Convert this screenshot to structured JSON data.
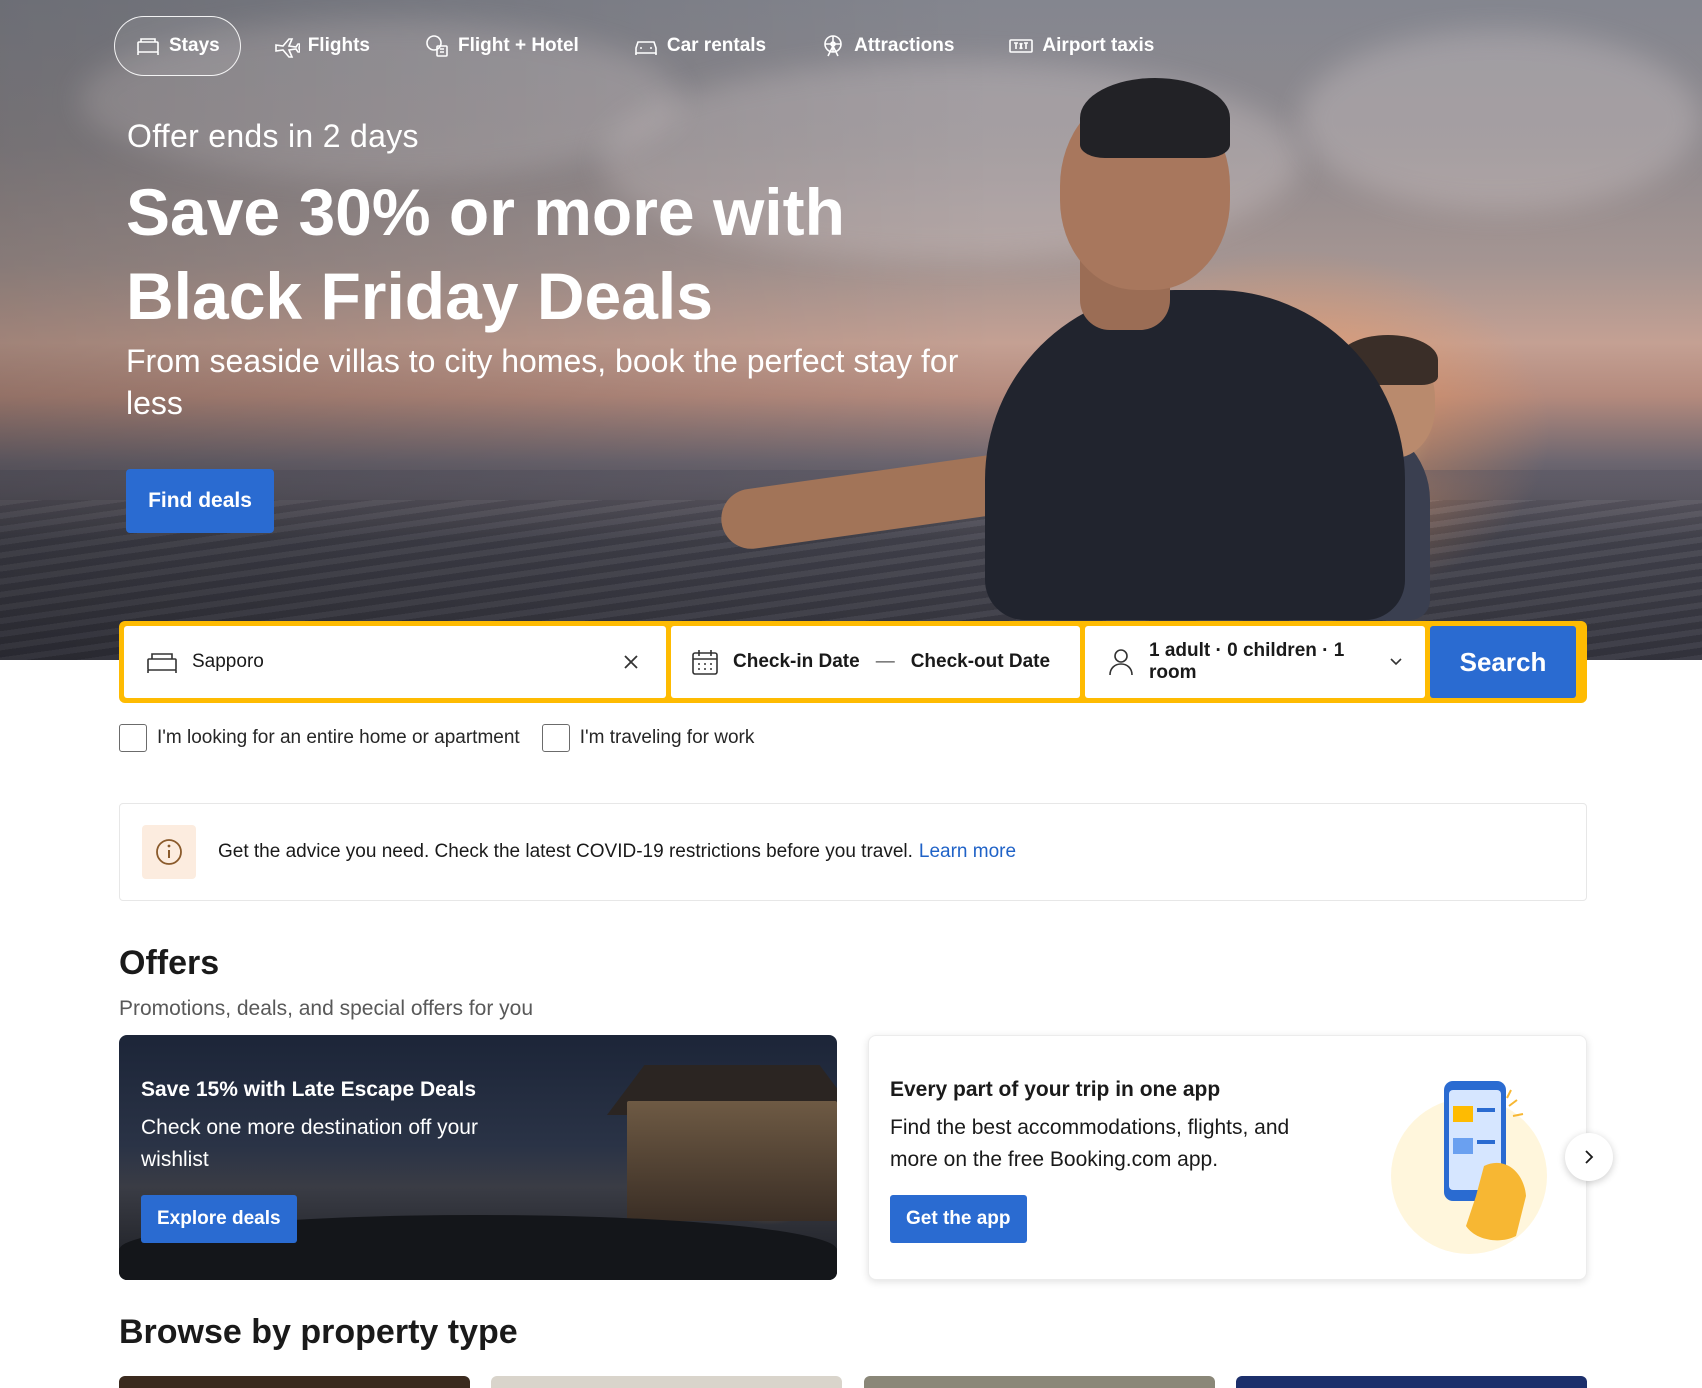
{
  "nav": {
    "items": [
      {
        "label": "Stays",
        "icon": "bed-icon",
        "active": true
      },
      {
        "label": "Flights",
        "icon": "plane-icon",
        "active": false
      },
      {
        "label": "Flight + Hotel",
        "icon": "flight-hotel-icon",
        "active": false
      },
      {
        "label": "Car rentals",
        "icon": "car-icon",
        "active": false
      },
      {
        "label": "Attractions",
        "icon": "ferris-wheel-icon",
        "active": false
      },
      {
        "label": "Airport taxis",
        "icon": "taxi-icon",
        "active": false
      }
    ]
  },
  "hero": {
    "offer_ends": "Offer ends in 2 days",
    "title": "Save 30% or more with Black Friday Deals",
    "subtitle": "From seaside villas to city homes, book the perfect stay for less",
    "cta": "Find deals"
  },
  "search": {
    "destination": "Sapporo",
    "checkin": "Check-in Date",
    "dash": "—",
    "checkout": "Check-out Date",
    "guests": "1 adult · 0 children · 1 room",
    "button": "Search"
  },
  "filters": {
    "entire_home": "I'm looking for an entire home or apartment",
    "work_travel": "I'm traveling for work"
  },
  "notice": {
    "message": "Get the advice you need. Check the latest COVID-19 restrictions before you travel.",
    "link": "Learn more"
  },
  "offers": {
    "title": "Offers",
    "subtitle": "Promotions, deals, and special offers for you",
    "cards": [
      {
        "title": "Save 15% with Late Escape Deals",
        "body": "Check one more destination off your wishlist",
        "button": "Explore deals"
      },
      {
        "title": "Every part of your trip in one app",
        "body": "Find the best accommodations, flights, and more on the free Booking.com app.",
        "button": "Get the app"
      }
    ]
  },
  "browse": {
    "title": "Browse by property type"
  },
  "colors": {
    "brand_blue": "#2a6bd1",
    "search_border_yellow": "#febb02",
    "link_blue": "#1f62c7"
  }
}
